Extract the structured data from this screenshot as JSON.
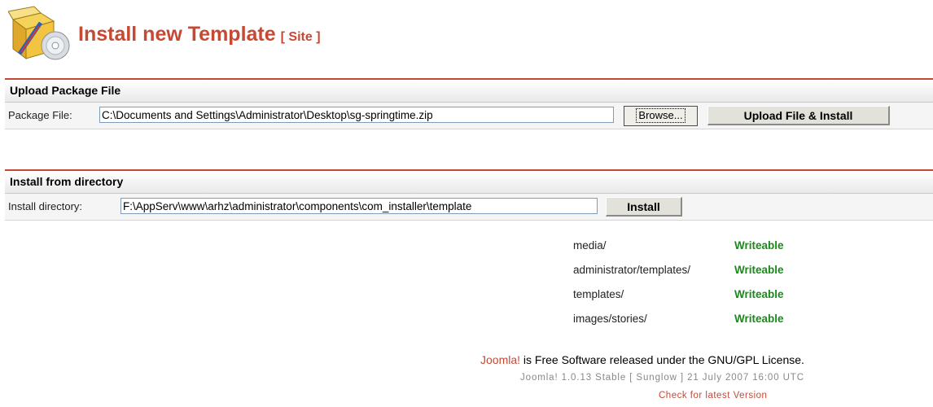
{
  "header": {
    "title": "Install new Template",
    "site_tag": "[ Site ]",
    "icon": "installer-package-icon"
  },
  "upload_section": {
    "title": "Upload Package File",
    "label": "Package File:",
    "file_value": "C:\\Documents and Settings\\Administrator\\Desktop\\sg-springtime.zip",
    "browse_label": "Browse...",
    "submit_label": "Upload File & Install"
  },
  "directory_section": {
    "title": "Install from directory",
    "label": "Install directory:",
    "dir_value": "F:\\AppServ\\www\\arhz\\administrator\\components\\com_installer\\template",
    "submit_label": "Install"
  },
  "permissions": [
    {
      "path": "media/",
      "status": "Writeable"
    },
    {
      "path": "administrator/templates/",
      "status": "Writeable"
    },
    {
      "path": "templates/",
      "status": "Writeable"
    },
    {
      "path": "images/stories/",
      "status": "Writeable"
    }
  ],
  "footer": {
    "joomla_link": "Joomla!",
    "license_text": " is Free Software released under the GNU/GPL License.",
    "version_text": "Joomla! 1.0.13 Stable [ Sunglow ] 21 July 2007 16:00 UTC",
    "check_version_link": "Check for latest Version"
  },
  "colors": {
    "accent": "#c64934",
    "writeable": "#1b8a1b"
  }
}
